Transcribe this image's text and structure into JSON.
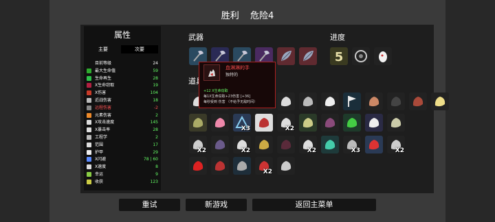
{
  "header": {
    "result": "胜利",
    "danger": "危险4"
  },
  "stats_panel": {
    "title": "属性",
    "tabs": {
      "main": "主要",
      "secondary": "次要"
    },
    "rows": [
      {
        "label": "目前等级",
        "value": "24",
        "color": "#ffffff",
        "label_color": "#ffffff",
        "icon": "level-icon",
        "icon_color": "#111111"
      },
      {
        "label": "最大生命值",
        "value": "59",
        "color": "#66ff66",
        "label_color": "#ffffff",
        "icon": "heart-icon",
        "icon_color": "#2eaa2e"
      },
      {
        "label": "生命再生",
        "value": "28",
        "color": "#66ff66",
        "label_color": "#ffffff",
        "icon": "regen-icon",
        "icon_color": "#2ec04a"
      },
      {
        "label": "X生命窃取",
        "value": "19",
        "color": "#66ff66",
        "label_color": "#ffffff",
        "icon": "lifesteal-icon",
        "icon_color": "#b02040"
      },
      {
        "label": "X伤害",
        "value": "104",
        "color": "#66ff66",
        "label_color": "#ffffff",
        "icon": "damage-icon",
        "icon_color": "#c83a28"
      },
      {
        "label": "近战伤害",
        "value": "18",
        "color": "#66ff66",
        "label_color": "#ffffff",
        "icon": "melee-icon",
        "icon_color": "#bbbbbb"
      },
      {
        "label": "远程伤害",
        "value": "-2",
        "color": "#ff5555",
        "label_color": "#ff5555",
        "icon": "ranged-icon",
        "icon_color": "#888888"
      },
      {
        "label": "元素伤害",
        "value": "2",
        "color": "#66ff66",
        "label_color": "#ffffff",
        "icon": "elemental-icon",
        "icon_color": "#ee8a2a"
      },
      {
        "label": "X攻击速度",
        "value": "145",
        "color": "#66ff66",
        "label_color": "#ffffff",
        "icon": "attack-speed-icon",
        "icon_color": "#dddddd"
      },
      {
        "label": "X暴击率",
        "value": "28",
        "color": "#66ff66",
        "label_color": "#ffffff",
        "icon": "crit-icon",
        "icon_color": "#dddddd"
      },
      {
        "label": "工程学",
        "value": "2",
        "color": "#66ff66",
        "label_color": "#ffffff",
        "icon": "engineering-icon",
        "icon_color": "#bbbbbb"
      },
      {
        "label": "范围",
        "value": "17",
        "color": "#66ff66",
        "label_color": "#ffffff",
        "icon": "range-icon",
        "icon_color": "#dddddd"
      },
      {
        "label": "护甲",
        "value": "29",
        "color": "#66ff66",
        "label_color": "#ffffff",
        "icon": "armor-icon",
        "icon_color": "#eeeeee"
      },
      {
        "label": "X闪避",
        "value": "78 | 60",
        "color": "#66ff66",
        "label_color": "#ffffff",
        "icon": "dodge-icon",
        "icon_color": "#5a8aff"
      },
      {
        "label": "X速度",
        "value": "8",
        "color": "#66ff66",
        "label_color": "#ffffff",
        "icon": "speed-icon",
        "icon_color": "#dddddd"
      },
      {
        "label": "幸运",
        "value": "9",
        "color": "#66ff66",
        "label_color": "#ffffff",
        "icon": "luck-icon",
        "icon_color": "#88cc44"
      },
      {
        "label": "收获",
        "value": "123",
        "color": "#66ff66",
        "label_color": "#ffffff",
        "icon": "harvest-icon",
        "icon_color": "#cccc44"
      }
    ]
  },
  "weapons": {
    "title": "武器",
    "items": [
      {
        "name": "axe-weapon-1",
        "bg": "#2a4a60",
        "kind": "axe",
        "count": ""
      },
      {
        "name": "axe-weapon-2",
        "bg": "#2a2a55",
        "kind": "axe",
        "count": ""
      },
      {
        "name": "axe-weapon-3",
        "bg": "#2a4a60",
        "kind": "axe",
        "count": ""
      },
      {
        "name": "axe-weapon-4",
        "bg": "#4a2a60",
        "kind": "axe",
        "count": ""
      },
      {
        "name": "leaf-weapon-1",
        "bg": "#602a30",
        "kind": "leaf",
        "count": ""
      },
      {
        "name": "leaf-weapon-2",
        "bg": "#602a30",
        "kind": "leaf",
        "count": ""
      }
    ]
  },
  "progress": {
    "title": "进度",
    "items": [
      {
        "name": "danger-five",
        "bg": "#3a3a20",
        "kind": "five",
        "count": ""
      },
      {
        "name": "wheel-item",
        "bg": "#222222",
        "kind": "wheel",
        "count": ""
      },
      {
        "name": "egg-item",
        "bg": "#222222",
        "kind": "egg",
        "count": ""
      }
    ]
  },
  "items_section": {
    "title": "道具",
    "rows": [
      [
        {
          "name": "item-hand-1",
          "bg": "#222222",
          "kind": "blob",
          "color": "#dddddd",
          "count": ""
        },
        {
          "name": "item-hand-2",
          "bg": "#222222",
          "kind": "blob",
          "color": "#cccccc",
          "count": ""
        },
        {
          "name": "item-hand-3",
          "bg": "#222222",
          "kind": "blob",
          "color": "#bbbbbb",
          "count": ""
        },
        {
          "name": "item-hand-4",
          "bg": "#222222",
          "kind": "blob",
          "color": "#aaaaaa",
          "count": ""
        },
        {
          "name": "item-5",
          "bg": "#222222",
          "kind": "blob",
          "color": "#dddddd",
          "count": ""
        },
        {
          "name": "item-6",
          "bg": "#222222",
          "kind": "blob",
          "color": "#bbbbbb",
          "count": ""
        },
        {
          "name": "item-rabbit",
          "bg": "#222222",
          "kind": "blob",
          "color": "#eeeeee",
          "count": ""
        },
        {
          "name": "item-flag",
          "bg": "#1a2e3a",
          "kind": "flag",
          "color": "#eeeeee",
          "count": ""
        },
        {
          "name": "item-horn",
          "bg": "#222222",
          "kind": "blob",
          "color": "#cc8866",
          "count": ""
        },
        {
          "name": "item-dark",
          "bg": "#222222",
          "kind": "blob",
          "color": "#444444",
          "count": ""
        },
        {
          "name": "item-claw",
          "bg": "#222222",
          "kind": "blob",
          "color": "#aa4a3a",
          "count": ""
        },
        {
          "name": "item-cup",
          "bg": "#222222",
          "kind": "blob",
          "color": "#eedd88",
          "count": ""
        }
      ],
      [
        {
          "name": "item-helmet",
          "bg": "#3a3a28",
          "kind": "blob",
          "color": "#aaaa66",
          "count": ""
        },
        {
          "name": "item-pig",
          "bg": "#222222",
          "kind": "blob",
          "color": "#ee88aa",
          "count": ""
        },
        {
          "name": "item-triangle",
          "bg": "#2a3a55",
          "kind": "tri",
          "color": "#88ccee",
          "count": "X3"
        },
        {
          "name": "item-bloody-hand",
          "bg": "#dddddd",
          "kind": "blob",
          "color": "#bb3333",
          "count": ""
        },
        {
          "name": "item-glove",
          "bg": "#222222",
          "kind": "blob",
          "color": "#dddddd",
          "count": "X2"
        },
        {
          "name": "item-map",
          "bg": "#2a3a28",
          "kind": "blob",
          "color": "#cccc88",
          "count": ""
        },
        {
          "name": "item-tentacle",
          "bg": "#222222",
          "kind": "blob",
          "color": "#8a4a7a",
          "count": ""
        },
        {
          "name": "item-potion",
          "bg": "#1e3a2a",
          "kind": "blob",
          "color": "#44cc44",
          "count": ""
        },
        {
          "name": "item-candle",
          "bg": "#2a2a44",
          "kind": "blob",
          "color": "#eeeeee",
          "count": ""
        },
        {
          "name": "item-saucer",
          "bg": "#222222",
          "kind": "blob",
          "color": "#ccccaa",
          "count": ""
        }
      ],
      [
        {
          "name": "item-bug",
          "bg": "#222222",
          "kind": "blob",
          "color": "#cccccc",
          "count": "X2"
        },
        {
          "name": "item-scarab",
          "bg": "#222222",
          "kind": "blob",
          "color": "#6a5a8a",
          "count": ""
        },
        {
          "name": "item-bow",
          "bg": "#222222",
          "kind": "blob",
          "color": "#dddddd",
          "count": "X2"
        },
        {
          "name": "item-crown",
          "bg": "#222222",
          "kind": "blob",
          "color": "#ccaa44",
          "count": ""
        },
        {
          "name": "item-bone",
          "bg": "#222222",
          "kind": "blob",
          "color": "#5a2a3a",
          "count": ""
        },
        {
          "name": "item-arrow",
          "bg": "#222222",
          "kind": "blob",
          "color": "#dddddd",
          "count": "X2"
        },
        {
          "name": "item-snake",
          "bg": "#1e3a3a",
          "kind": "blob",
          "color": "#44ccaa",
          "count": ""
        },
        {
          "name": "item-trident",
          "bg": "#222222",
          "kind": "blob",
          "color": "#bbbbbb",
          "count": "X3"
        },
        {
          "name": "item-ring",
          "bg": "#2a3a55",
          "kind": "blob",
          "color": "#dd3333",
          "count": ""
        },
        {
          "name": "item-robot",
          "bg": "#222222",
          "kind": "blob",
          "color": "#cccccc",
          "count": "X2"
        }
      ],
      [
        {
          "name": "item-rose",
          "bg": "#222222",
          "kind": "blob",
          "color": "#dd2222",
          "count": ""
        },
        {
          "name": "item-syringe",
          "bg": "#222222",
          "kind": "blob",
          "color": "#bb3333",
          "count": ""
        },
        {
          "name": "item-hook",
          "bg": "#1e2e3a",
          "kind": "blob",
          "color": "#aaaaaa",
          "count": ""
        },
        {
          "name": "item-knife",
          "bg": "#222222",
          "kind": "blob",
          "color": "#cc3333",
          "count": "X2"
        },
        {
          "name": "item-cap",
          "bg": "#222222",
          "kind": "blob",
          "color": "#cccccc",
          "count": ""
        }
      ]
    ]
  },
  "tooltip": {
    "name": "血淋淋的手",
    "rarity": "独特的",
    "effects": [
      "+12 X生命窃取",
      "每1X生命窃取+23伤害 [+36]",
      "每秒受到 伤害 （不给予无敌时间）"
    ],
    "colors": {
      "name": "#ff5050",
      "positive": "#66ff66",
      "border": "#b02020"
    }
  },
  "buttons": {
    "retry": "重试",
    "new_game": "新游戏",
    "main_menu": "返回主菜单"
  }
}
